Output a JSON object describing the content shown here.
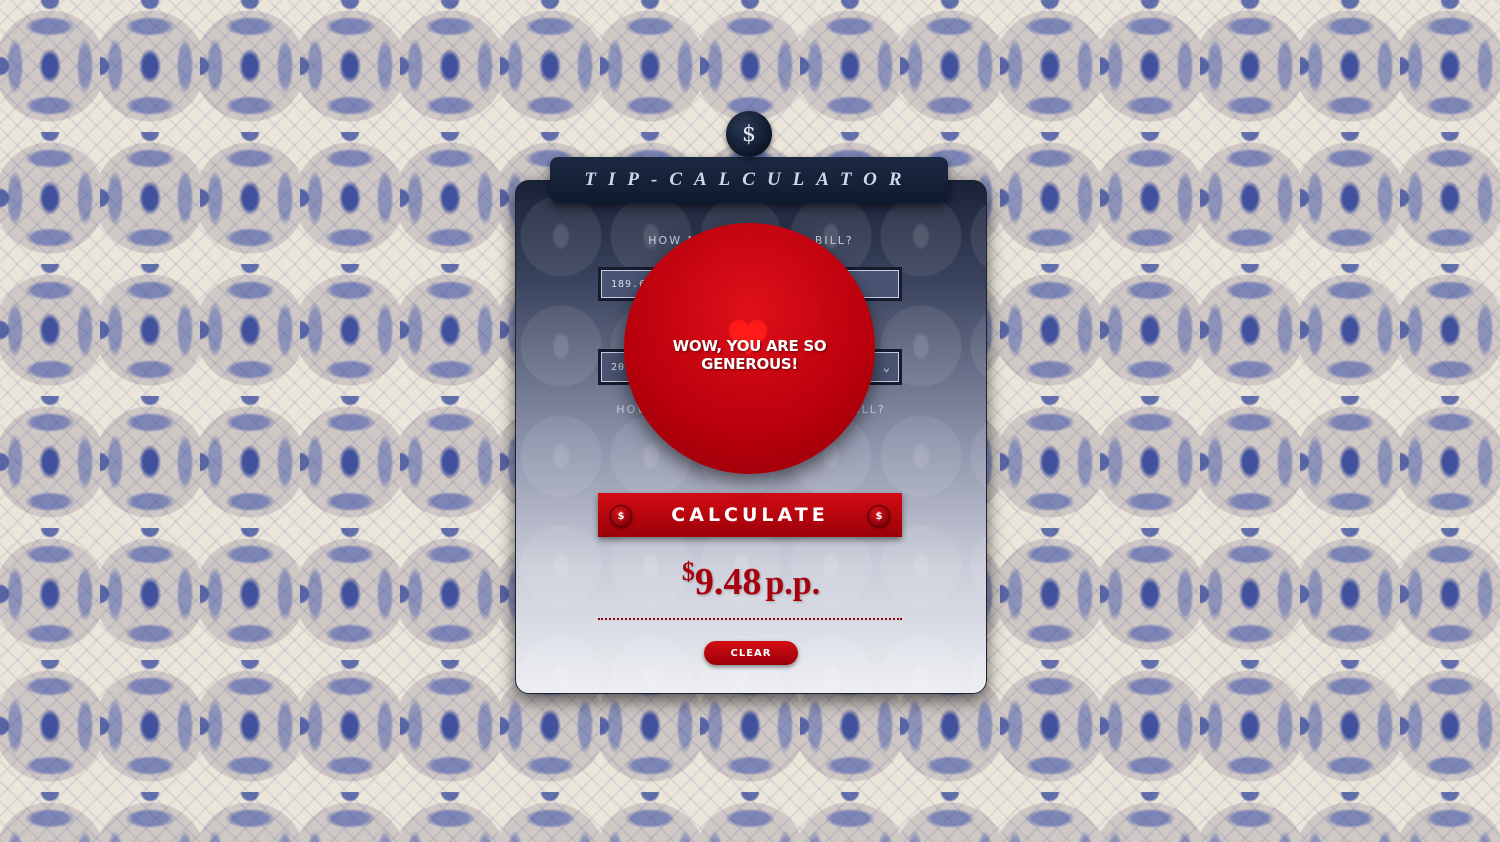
{
  "app": {
    "coin_symbol": "$",
    "title": "TIP-CALCULATOR"
  },
  "form": {
    "bill_label": "How much was your bill?",
    "bill_value": "189.65",
    "service_value": "20",
    "people_label": "How many people share the bill?"
  },
  "buttons": {
    "calculate_label": "CALCULATE",
    "coin_symbol": "$",
    "clear_label": "CLEAR"
  },
  "result": {
    "currency": "$",
    "amount": "9.48",
    "suffix": "p.p."
  },
  "overlay": {
    "message": "WOW, YOU ARE SO GENEROUS!",
    "icon": "heart-icon"
  },
  "colors": {
    "accent_red": "#c4000c",
    "navy": "#0e1a2e",
    "result_text": "#a8000c"
  }
}
